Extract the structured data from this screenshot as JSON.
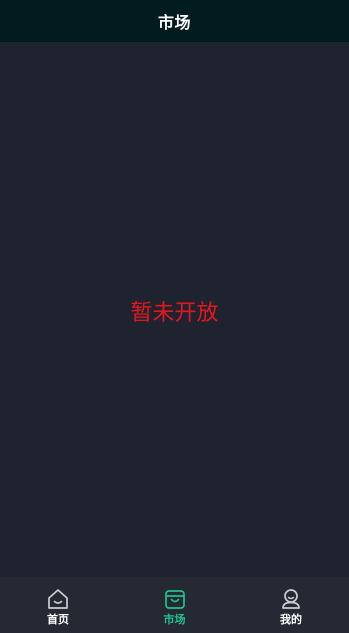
{
  "header": {
    "title": "市场"
  },
  "main": {
    "notice": "暂未开放"
  },
  "tabbar": {
    "items": [
      {
        "label": "首页",
        "icon": "home-icon",
        "active": false
      },
      {
        "label": "市场",
        "icon": "shopping-bag-icon",
        "active": true
      },
      {
        "label": "我的",
        "icon": "user-icon",
        "active": false
      }
    ]
  },
  "colors": {
    "header_bg": "#011b1e",
    "page_bg": "#1f2330",
    "tabbar_bg": "#252933",
    "notice": "#e6161e",
    "active": "#22c28a",
    "inactive_icon": "#c9ccd3"
  }
}
